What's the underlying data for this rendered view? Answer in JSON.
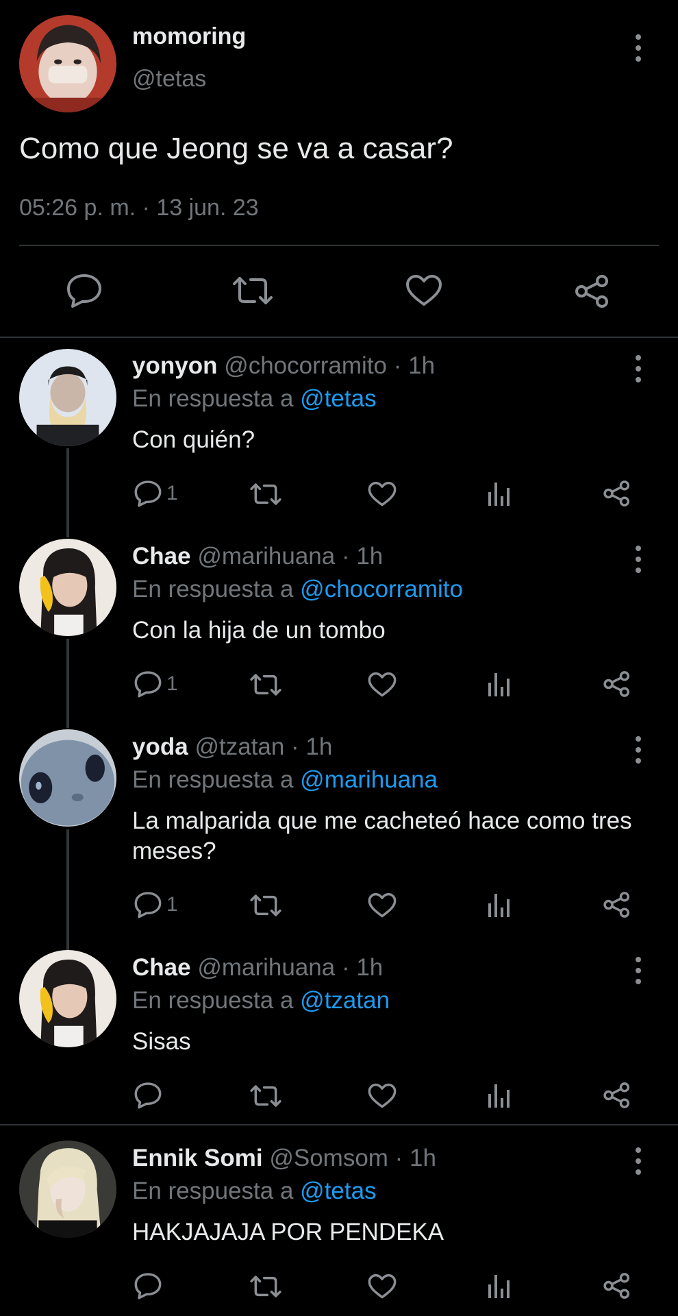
{
  "main": {
    "name": "momoring",
    "handle": "@tetas",
    "text": "Como que Jeong se va a casar?",
    "timestamp": "05:26 p. m. · 13 jun. 23"
  },
  "replies": [
    {
      "name": "yonyon",
      "meta": "@chocorramito · 1h",
      "in_reply_prefix": "En respuesta a",
      "mention": "@tetas",
      "text": "Con quién?",
      "reply_count": "1"
    },
    {
      "name": "Chae",
      "meta": "@marihuana · 1h",
      "in_reply_prefix": "En respuesta a",
      "mention": "@chocorramito",
      "text": "Con la hija de un tombo",
      "reply_count": "1"
    },
    {
      "name": "yoda",
      "meta": "@tzatan · 1h",
      "in_reply_prefix": "En respuesta a",
      "mention": "@marihuana",
      "text": "La malparida que me cacheteó hace como tres meses?",
      "reply_count": "1"
    },
    {
      "name": "Chae",
      "meta": "@marihuana · 1h",
      "in_reply_prefix": "En respuesta a",
      "mention": "@tzatan",
      "text": "Sisas",
      "reply_count": ""
    },
    {
      "name": "Ennik Somi",
      "meta": "@Somsom · 1h",
      "in_reply_prefix": "En respuesta a",
      "mention": "@tetas",
      "text": "HAKJAJAJA POR PENDEKA",
      "reply_count": ""
    }
  ],
  "colors": {
    "background": "#000000",
    "text": "#e7e9ea",
    "muted": "#71767b",
    "mention": "#1d9bf0",
    "divider": "#2f3336"
  },
  "icons": [
    "reply-icon",
    "retweet-icon",
    "like-icon",
    "analytics-icon",
    "share-icon",
    "more-icon"
  ]
}
